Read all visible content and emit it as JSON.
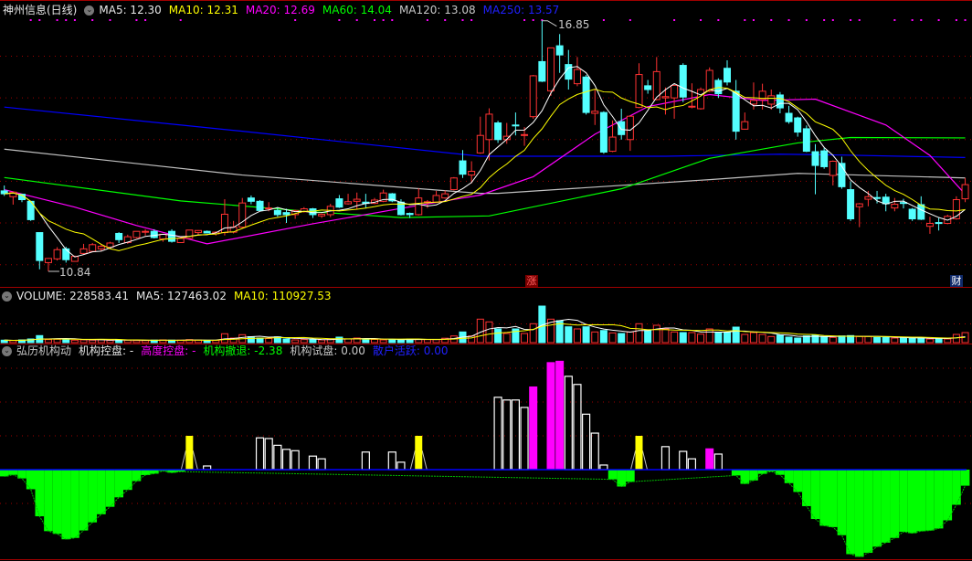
{
  "header": {
    "title": "神州信息(日线)",
    "ma5": "MA5: 12.30",
    "ma10": "MA10: 12.31",
    "ma20": "MA20: 12.69",
    "ma60": "MA60: 14.04",
    "ma120": "MA120: 13.08",
    "ma250": "MA250: 13.57"
  },
  "annotations": {
    "high_label": "16.85",
    "low_label": "10.84",
    "marker_zhang": "涨",
    "marker_cai": "财"
  },
  "volume_header": {
    "volume": "VOLUME: 228583.41",
    "ma5": "MA5: 127463.02",
    "ma10": "MA10: 110927.53"
  },
  "indicator_header": {
    "name": "弘历机构动",
    "control": "机构控盘: -",
    "high_control": "高度控盘: -",
    "retreat": "机构撤退: -2.38",
    "test": "机构试盘: 0.00",
    "retail": "散户活跃: 0.00"
  },
  "colors": {
    "up": "#ff3232",
    "down": "#54ffff",
    "ma5": "#ffffff",
    "ma10": "#ffff00",
    "ma20": "#ff00ff",
    "ma60": "#00ff00",
    "ma120": "#c0c0c0",
    "ma250": "#0000ff",
    "grid": "#a00000"
  },
  "chart_data": {
    "type": "candlestick",
    "title": "神州信息(日线)",
    "price_range": [
      10.84,
      16.85
    ],
    "grid_prices": [
      16,
      15,
      14,
      13,
      12,
      11
    ],
    "candles_ohlc": [
      [
        12.77,
        12.9,
        12.65,
        12.7
      ],
      [
        12.63,
        12.74,
        12.44,
        12.74
      ],
      [
        12.69,
        12.7,
        12.5,
        12.56
      ],
      [
        12.52,
        12.52,
        12.05,
        12.08
      ],
      [
        11.77,
        11.77,
        10.89,
        11.1
      ],
      [
        11.05,
        11.16,
        10.84,
        11.15
      ],
      [
        11.14,
        11.42,
        11.1,
        11.36
      ],
      [
        11.38,
        11.43,
        11.05,
        11.12
      ],
      [
        11.08,
        11.22,
        11.07,
        11.2
      ],
      [
        11.27,
        11.5,
        11.25,
        11.38
      ],
      [
        11.32,
        11.52,
        11.3,
        11.48
      ],
      [
        11.38,
        11.5,
        11.33,
        11.44
      ],
      [
        11.42,
        11.55,
        11.4,
        11.52
      ],
      [
        11.75,
        11.78,
        11.52,
        11.6
      ],
      [
        11.53,
        11.72,
        11.5,
        11.67
      ],
      [
        11.65,
        11.8,
        11.63,
        11.8
      ],
      [
        11.79,
        11.85,
        11.7,
        11.8
      ],
      [
        11.8,
        11.85,
        11.63,
        11.65
      ],
      [
        11.62,
        11.73,
        11.55,
        11.73
      ],
      [
        11.8,
        11.85,
        11.53,
        11.56
      ],
      [
        11.53,
        11.63,
        11.52,
        11.63
      ],
      [
        11.63,
        11.83,
        11.62,
        11.83
      ],
      [
        11.77,
        11.83,
        11.72,
        11.82
      ],
      [
        11.8,
        11.82,
        11.75,
        11.76
      ],
      [
        11.74,
        11.8,
        11.7,
        11.78
      ],
      [
        11.77,
        12.57,
        11.7,
        12.21
      ],
      [
        11.78,
        12.05,
        11.75,
        11.9
      ],
      [
        11.9,
        12.6,
        11.88,
        12.48
      ],
      [
        12.6,
        12.66,
        12.45,
        12.52
      ],
      [
        12.52,
        12.55,
        12.28,
        12.3
      ],
      [
        12.34,
        12.5,
        12.28,
        12.36
      ],
      [
        12.3,
        12.38,
        12.15,
        12.2
      ],
      [
        12.25,
        12.34,
        12.0,
        12.2
      ],
      [
        12.2,
        12.32,
        12.1,
        12.3
      ],
      [
        12.27,
        12.38,
        12.25,
        12.34
      ],
      [
        12.34,
        12.36,
        12.12,
        12.2
      ],
      [
        12.17,
        12.23,
        12.12,
        12.21
      ],
      [
        12.2,
        12.46,
        12.14,
        12.4
      ],
      [
        12.58,
        12.67,
        12.36,
        12.38
      ],
      [
        12.46,
        12.7,
        12.44,
        12.51
      ],
      [
        12.52,
        12.73,
        12.33,
        12.57
      ],
      [
        12.5,
        12.7,
        12.35,
        12.47
      ],
      [
        12.47,
        12.6,
        12.45,
        12.55
      ],
      [
        12.52,
        12.8,
        12.5,
        12.72
      ],
      [
        12.7,
        12.72,
        12.5,
        12.53
      ],
      [
        12.5,
        12.57,
        12.18,
        12.2
      ],
      [
        12.23,
        12.25,
        12.12,
        12.2
      ],
      [
        12.2,
        12.83,
        12.18,
        12.6
      ],
      [
        12.5,
        12.55,
        12.36,
        12.51
      ],
      [
        12.5,
        12.77,
        12.48,
        12.66
      ],
      [
        12.6,
        12.78,
        12.58,
        12.7
      ],
      [
        12.8,
        13.1,
        12.78,
        13.08
      ],
      [
        13.49,
        13.75,
        13.08,
        13.17
      ],
      [
        13.15,
        13.48,
        12.95,
        13.24
      ],
      [
        13.68,
        14.55,
        13.66,
        14.1
      ],
      [
        14.0,
        14.75,
        13.5,
        14.61
      ],
      [
        14.4,
        14.45,
        13.92,
        14.0
      ],
      [
        14.0,
        14.4,
        13.9,
        14.08
      ],
      [
        14.35,
        14.65,
        14.1,
        14.33
      ],
      [
        14.1,
        14.3,
        13.85,
        14.12
      ],
      [
        14.55,
        15.55,
        14.5,
        15.53
      ],
      [
        15.87,
        16.85,
        15.38,
        15.4
      ],
      [
        15.17,
        16.2,
        15.05,
        16.2
      ],
      [
        16.25,
        16.53,
        15.6,
        16.03
      ],
      [
        15.8,
        16.15,
        15.2,
        15.45
      ],
      [
        15.34,
        15.98,
        15.28,
        15.68
      ],
      [
        15.5,
        15.55,
        14.6,
        14.65
      ],
      [
        14.63,
        15.2,
        14.35,
        14.68
      ],
      [
        14.65,
        14.68,
        13.66,
        13.7
      ],
      [
        13.72,
        14.46,
        13.7,
        14.06
      ],
      [
        14.43,
        14.74,
        14.0,
        14.12
      ],
      [
        14.0,
        14.58,
        13.73,
        14.56
      ],
      [
        14.77,
        15.83,
        14.75,
        15.56
      ],
      [
        15.29,
        15.43,
        15.1,
        15.2
      ],
      [
        14.96,
        15.98,
        14.94,
        15.63
      ],
      [
        15.0,
        15.25,
        14.6,
        15.03
      ],
      [
        15.0,
        15.3,
        14.5,
        15.3
      ],
      [
        15.78,
        15.83,
        14.9,
        15.02
      ],
      [
        14.8,
        15.35,
        14.75,
        14.8
      ],
      [
        14.74,
        15.25,
        14.72,
        15.2
      ],
      [
        15.16,
        15.73,
        15.14,
        15.66
      ],
      [
        15.42,
        15.47,
        15.0,
        15.1
      ],
      [
        15.71,
        15.9,
        15.3,
        15.38
      ],
      [
        15.16,
        15.43,
        14.0,
        14.2
      ],
      [
        14.25,
        14.65,
        14.24,
        14.43
      ],
      [
        14.85,
        15.37,
        14.72,
        14.94
      ],
      [
        14.96,
        15.34,
        14.72,
        15.16
      ],
      [
        14.85,
        15.2,
        14.72,
        15.05
      ],
      [
        15.07,
        15.14,
        14.63,
        14.76
      ],
      [
        14.63,
        14.81,
        14.38,
        14.43
      ],
      [
        14.52,
        14.55,
        14.07,
        14.18
      ],
      [
        14.26,
        14.34,
        13.7,
        13.72
      ],
      [
        13.71,
        13.89,
        12.69,
        13.38
      ],
      [
        13.73,
        13.8,
        13.3,
        13.35
      ],
      [
        13.14,
        13.5,
        12.9,
        13.48
      ],
      [
        13.43,
        13.59,
        12.82,
        12.87
      ],
      [
        12.8,
        13.0,
        12.05,
        12.1
      ],
      [
        12.39,
        12.48,
        11.9,
        12.46
      ],
      [
        12.57,
        12.77,
        12.4,
        12.63
      ],
      [
        12.61,
        12.77,
        12.47,
        12.6
      ],
      [
        12.62,
        12.7,
        12.28,
        12.46
      ],
      [
        12.36,
        12.6,
        12.28,
        12.45
      ],
      [
        12.49,
        12.58,
        12.35,
        12.48
      ],
      [
        12.33,
        12.36,
        12.05,
        12.1
      ],
      [
        12.44,
        12.64,
        12.07,
        12.09
      ],
      [
        11.92,
        12.15,
        11.74,
        11.99
      ],
      [
        12.01,
        12.12,
        11.82,
        12.0
      ],
      [
        11.99,
        12.2,
        11.97,
        12.16
      ],
      [
        12.1,
        12.64,
        12.08,
        12.56
      ],
      [
        12.58,
        13.08,
        12.5,
        12.92
      ]
    ],
    "ma_computed": [
      {
        "name": "MA5",
        "period": 5,
        "color": "#ffffff"
      },
      {
        "name": "MA10",
        "period": 10,
        "color": "#ffff00"
      }
    ],
    "ma_lines": [
      {
        "name": "MA20",
        "color": "#ff00ff",
        "points": [
          [
            0,
            12.8
          ],
          [
            8,
            12.38
          ],
          [
            15,
            11.94
          ],
          [
            23,
            11.5
          ],
          [
            35,
            11.98
          ],
          [
            45,
            12.35
          ],
          [
            54,
            12.67
          ],
          [
            60,
            13.11
          ],
          [
            67,
            14.13
          ],
          [
            73,
            14.79
          ],
          [
            80,
            15.08
          ],
          [
            86,
            14.94
          ],
          [
            92,
            14.97
          ],
          [
            100,
            14.35
          ],
          [
            105,
            13.62
          ],
          [
            109,
            12.69
          ]
        ]
      },
      {
        "name": "MA60",
        "color": "#00ff00",
        "points": [
          [
            0,
            13.09
          ],
          [
            20,
            12.53
          ],
          [
            35,
            12.27
          ],
          [
            45,
            12.13
          ],
          [
            55,
            12.17
          ],
          [
            70,
            12.82
          ],
          [
            80,
            13.55
          ],
          [
            90,
            13.92
          ],
          [
            96,
            14.05
          ],
          [
            109,
            14.04
          ]
        ]
      },
      {
        "name": "MA120",
        "color": "#c0c0c0",
        "points": [
          [
            0,
            13.77
          ],
          [
            27,
            13.15
          ],
          [
            54,
            12.71
          ],
          [
            56,
            12.71
          ],
          [
            80,
            13.04
          ],
          [
            90,
            13.19
          ],
          [
            109,
            13.08
          ]
        ]
      },
      {
        "name": "MA250",
        "color": "#0000ff",
        "points": [
          [
            0,
            14.78
          ],
          [
            27,
            14.2
          ],
          [
            54,
            13.6
          ],
          [
            75,
            13.6
          ],
          [
            88,
            13.65
          ],
          [
            95,
            13.63
          ],
          [
            109,
            13.57
          ]
        ]
      }
    ],
    "signal_dots": [
      3,
      4,
      6,
      7,
      8,
      10,
      12,
      15,
      16,
      20,
      33,
      38,
      40,
      42,
      43,
      44,
      48,
      50,
      52,
      53,
      59,
      60,
      61,
      68,
      71,
      76,
      79,
      81,
      84,
      85,
      87,
      89,
      91,
      93,
      94,
      96,
      97,
      101,
      103,
      104,
      106,
      108,
      109
    ],
    "volume_k": [
      56,
      48,
      62,
      83,
      160,
      69,
      77,
      83,
      56,
      62,
      56,
      62,
      52,
      62,
      56,
      48,
      48,
      56,
      62,
      56,
      56,
      69,
      56,
      48,
      52,
      202,
      104,
      181,
      135,
      104,
      94,
      131,
      83,
      62,
      69,
      73,
      62,
      73,
      125,
      83,
      104,
      83,
      73,
      62,
      73,
      62,
      83,
      73,
      69,
      69,
      100,
      152,
      243,
      152,
      534,
      472,
      312,
      208,
      312,
      208,
      430,
      831,
      534,
      499,
      360,
      312,
      360,
      243,
      276,
      222,
      208,
      243,
      430,
      276,
      395,
      312,
      243,
      229,
      229,
      193,
      312,
      229,
      229,
      353,
      187,
      229,
      187,
      139,
      172,
      125,
      104,
      152,
      172,
      139,
      118,
      152,
      160,
      139,
      139,
      118,
      118,
      104,
      104,
      104,
      104,
      83,
      89,
      83,
      187,
      228.58341
    ],
    "indicator": {
      "retreat": [
        [
          0,
          -1.0
        ],
        [
          1,
          -0.77
        ],
        [
          2,
          -1.3
        ],
        [
          3,
          -2.9
        ],
        [
          4,
          -6.9
        ],
        [
          5,
          -9.1
        ],
        [
          6,
          -9.5
        ],
        [
          7,
          -10.3
        ],
        [
          8,
          -10.1
        ],
        [
          9,
          -9.0
        ],
        [
          10,
          -7.8
        ],
        [
          11,
          -6.6
        ],
        [
          12,
          -5.5
        ],
        [
          13,
          -4.1
        ],
        [
          14,
          -3.0
        ],
        [
          15,
          -1.7
        ],
        [
          16,
          -0.8
        ],
        [
          17,
          -0.6
        ],
        [
          18,
          -0.2
        ],
        [
          19,
          -0.45
        ],
        [
          20,
          -0.3
        ],
        [
          69,
          -1.44
        ],
        [
          70,
          -2.5
        ],
        [
          71,
          -1.8
        ],
        [
          83,
          -0.86
        ],
        [
          84,
          -2.1
        ],
        [
          85,
          -1.6
        ],
        [
          86,
          -0.63
        ],
        [
          87,
          -0.27
        ],
        [
          88,
          -0.77
        ],
        [
          89,
          -2.0
        ],
        [
          90,
          -3.3
        ],
        [
          91,
          -5.4
        ],
        [
          92,
          -7.3
        ],
        [
          93,
          -8.3
        ],
        [
          94,
          -8.5
        ],
        [
          95,
          -9.7
        ],
        [
          96,
          -12.5
        ],
        [
          97,
          -12.9
        ],
        [
          98,
          -12.3
        ],
        [
          99,
          -11.4
        ],
        [
          100,
          -10.8
        ],
        [
          101,
          -10.1
        ],
        [
          102,
          -9.2
        ],
        [
          103,
          -9.4
        ],
        [
          104,
          -9.1
        ],
        [
          105,
          -9.0
        ],
        [
          106,
          -8.7
        ],
        [
          107,
          -7.5
        ],
        [
          108,
          -5.2
        ],
        [
          109,
          -2.38
        ]
      ],
      "control": [
        [
          23,
          0.54
        ],
        [
          29,
          4.7
        ],
        [
          30,
          4.6
        ],
        [
          31,
          3.6
        ],
        [
          32,
          3.0
        ],
        [
          33,
          2.8
        ],
        [
          35,
          2.0
        ],
        [
          36,
          1.6
        ],
        [
          41,
          2.6
        ],
        [
          44,
          2.6
        ],
        [
          45,
          1.1
        ],
        [
          56,
          10.7
        ],
        [
          57,
          10.3
        ],
        [
          58,
          10.3
        ],
        [
          59,
          9.2
        ],
        [
          64,
          13.8
        ],
        [
          65,
          12.6
        ],
        [
          66,
          8.2
        ],
        [
          67,
          5.4
        ],
        [
          68,
          0.68
        ],
        [
          75,
          3.4
        ],
        [
          77,
          2.7
        ],
        [
          78,
          1.6
        ],
        [
          81,
          2.3
        ]
      ],
      "high_control": [
        [
          60,
          12.3
        ],
        [
          62,
          15.9
        ],
        [
          63,
          16.1
        ],
        [
          80,
          3.15
        ]
      ],
      "test": [
        [
          21,
          5
        ],
        [
          47,
          5
        ],
        [
          72,
          5
        ]
      ],
      "grid_values": [
        15,
        10,
        5,
        -5
      ]
    }
  }
}
